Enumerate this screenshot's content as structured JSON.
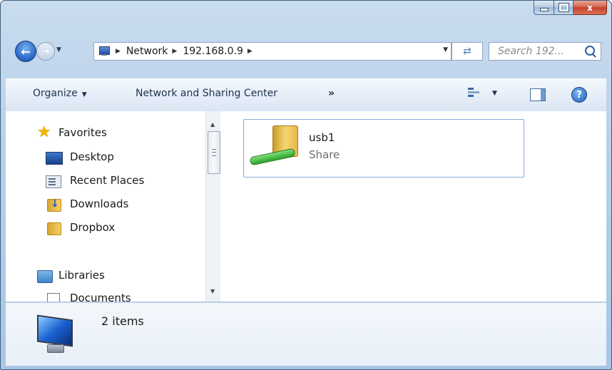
{
  "window": {
    "caption_buttons": {
      "minimize": "",
      "maximize": "",
      "close": "x"
    }
  },
  "nav": {
    "breadcrumbs": [
      "Network",
      "192.168.0.9"
    ],
    "search_placeholder": "Search 192..."
  },
  "commandbar": {
    "organize": "Organize",
    "network_sharing": "Network and Sharing Center",
    "more": "»",
    "help": "?"
  },
  "sidebar": {
    "favorites": "Favorites",
    "items": [
      "Desktop",
      "Recent Places",
      "Downloads",
      "Dropbox"
    ],
    "libraries": "Libraries",
    "library_items": [
      "Documents"
    ]
  },
  "main": {
    "items": [
      {
        "name": "usb1",
        "type": "Share"
      }
    ]
  },
  "details": {
    "item_count": "2 items"
  }
}
